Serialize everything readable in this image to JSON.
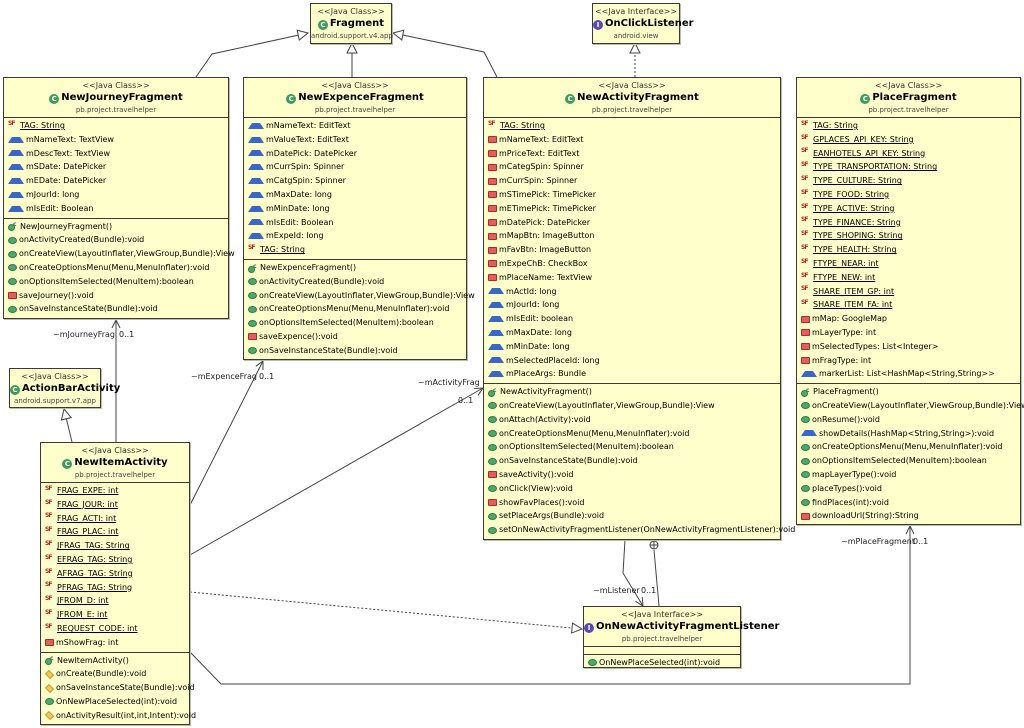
{
  "classes": {
    "fragment": {
      "stereotype": "<<Java Class>>",
      "name": "Fragment",
      "package": "android.support.v4.app",
      "kind": "class"
    },
    "onClickListener": {
      "stereotype": "<<Java Interface>>",
      "name": "OnClickListener",
      "package": "android.view",
      "kind": "interface"
    },
    "actionBarActivity": {
      "stereotype": "<<Java Class>>",
      "name": "ActionBarActivity",
      "package": "android.support.v7.app",
      "kind": "class"
    },
    "newJourneyFragment": {
      "stereotype": "<<Java Class>>",
      "name": "NewJourneyFragment",
      "package": "pb.project.travelhelper",
      "kind": "class",
      "fields": [
        {
          "vis": "sf",
          "text": "TAG: String",
          "static": true
        },
        {
          "vis": "pkgv",
          "text": "mNameText: TextView"
        },
        {
          "vis": "pkgv",
          "text": "mDescText: TextView"
        },
        {
          "vis": "pkgv",
          "text": "mSDate: DatePicker"
        },
        {
          "vis": "pkgv",
          "text": "mEDate: DatePicker"
        },
        {
          "vis": "pkgv",
          "text": "mJourId: long"
        },
        {
          "vis": "pkgv",
          "text": "mIsEdit: Boolean"
        }
      ],
      "methods": [
        {
          "vis": "ctor",
          "text": "NewJourneyFragment()"
        },
        {
          "vis": "pub",
          "text": "onActivityCreated(Bundle):void"
        },
        {
          "vis": "pub",
          "text": "onCreateView(LayoutInflater,ViewGroup,Bundle):View"
        },
        {
          "vis": "pub",
          "text": "onCreateOptionsMenu(Menu,MenuInflater):void"
        },
        {
          "vis": "pub",
          "text": "onOptionsItemSelected(MenuItem):boolean"
        },
        {
          "vis": "priv",
          "text": "saveJourney():void"
        },
        {
          "vis": "pub",
          "text": "onSaveInstanceState(Bundle):void"
        }
      ]
    },
    "newExpenceFragment": {
      "stereotype": "<<Java Class>>",
      "name": "NewExpenceFragment",
      "package": "pb.project.travelhelper",
      "kind": "class",
      "fields": [
        {
          "vis": "pkgv",
          "text": "mNameText: EditText"
        },
        {
          "vis": "pkgv",
          "text": "mValueText: EditText"
        },
        {
          "vis": "pkgv",
          "text": "mDatePick: DatePicker"
        },
        {
          "vis": "pkgv",
          "text": "mCurrSpin: Spinner"
        },
        {
          "vis": "pkgv",
          "text": "mCatgSpin: Spinner"
        },
        {
          "vis": "pkgv",
          "text": "mMaxDate: long"
        },
        {
          "vis": "pkgv",
          "text": "mMinDate: long"
        },
        {
          "vis": "pkgv",
          "text": "mIsEdit: Boolean"
        },
        {
          "vis": "pkgv",
          "text": "mExpeId: long"
        },
        {
          "vis": "sf",
          "text": "TAG: String",
          "static": true
        }
      ],
      "methods": [
        {
          "vis": "ctor",
          "text": "NewExpenceFragment()"
        },
        {
          "vis": "pub",
          "text": "onActivityCreated(Bundle):void"
        },
        {
          "vis": "pub",
          "text": "onCreateView(LayoutInflater,ViewGroup,Bundle):View"
        },
        {
          "vis": "pub",
          "text": "onCreateOptionsMenu(Menu,MenuInflater):void"
        },
        {
          "vis": "pub",
          "text": "onOptionsItemSelected(MenuItem):boolean"
        },
        {
          "vis": "priv",
          "text": "saveExpence():void"
        },
        {
          "vis": "pub",
          "text": "onSaveInstanceState(Bundle):void"
        }
      ]
    },
    "newActivityFragment": {
      "stereotype": "<<Java Class>>",
      "name": "NewActivityFragment",
      "package": "pb.project.travelhelper",
      "kind": "class",
      "fields": [
        {
          "vis": "sf",
          "text": "TAG: String",
          "static": true
        },
        {
          "vis": "priv",
          "text": "mNameText: EditText"
        },
        {
          "vis": "priv",
          "text": "mPriceText: EditText"
        },
        {
          "vis": "priv",
          "text": "mCategSpin: Spinner"
        },
        {
          "vis": "priv",
          "text": "mCurrSpin: Spinner"
        },
        {
          "vis": "priv",
          "text": "mSTimePick: TimePicker"
        },
        {
          "vis": "priv",
          "text": "mETimePick: TimePicker"
        },
        {
          "vis": "priv",
          "text": "mDatePick: DatePicker"
        },
        {
          "vis": "priv",
          "text": "mMapBtn: ImageButton"
        },
        {
          "vis": "priv",
          "text": "mFavBtn: ImageButton"
        },
        {
          "vis": "priv",
          "text": "mExpeChB: CheckBox"
        },
        {
          "vis": "priv",
          "text": "mPlaceName: TextView"
        },
        {
          "vis": "pkgv",
          "text": "mActId: long"
        },
        {
          "vis": "pkgv",
          "text": "mJourId: long"
        },
        {
          "vis": "pkgv",
          "text": "mIsEdit: boolean"
        },
        {
          "vis": "pkgv",
          "text": "mMaxDate: long"
        },
        {
          "vis": "pkgv",
          "text": "mMinDate: long"
        },
        {
          "vis": "pkgv",
          "text": "mSelectedPlaceId: long"
        },
        {
          "vis": "pkgv",
          "text": "mPlaceArgs: Bundle"
        }
      ],
      "methods": [
        {
          "vis": "ctor",
          "text": "NewActivityFragment()"
        },
        {
          "vis": "pub",
          "text": "onCreateView(LayoutInflater,ViewGroup,Bundle):View"
        },
        {
          "vis": "pub",
          "text": "onAttach(Activity):void"
        },
        {
          "vis": "pub",
          "text": "onCreateOptionsMenu(Menu,MenuInflater):void"
        },
        {
          "vis": "pub",
          "text": "onOptionsItemSelected(MenuItem):boolean"
        },
        {
          "vis": "pub",
          "text": "onSaveInstanceState(Bundle):void"
        },
        {
          "vis": "priv",
          "text": "saveActivity():void"
        },
        {
          "vis": "pub",
          "text": "onClick(View):void"
        },
        {
          "vis": "priv",
          "text": "showFavPlaces():void"
        },
        {
          "vis": "pub",
          "text": "setPlaceArgs(Bundle):void"
        },
        {
          "vis": "pub",
          "text": "setOnNewActivityFragmentListener(OnNewActivityFragmentListener):void"
        }
      ]
    },
    "placeFragment": {
      "stereotype": "<<Java Class>>",
      "name": "PlaceFragment",
      "package": "pb.project.travelhelper",
      "kind": "class",
      "fields": [
        {
          "vis": "sf",
          "text": "TAG: String",
          "static": true
        },
        {
          "vis": "sf",
          "text": "GPLACES_API_KEY: String",
          "static": true
        },
        {
          "vis": "sf",
          "text": "EANHOTELS_API_KEY: String",
          "static": true
        },
        {
          "vis": "sf",
          "text": "TYPE_TRANSPORTATION: String",
          "static": true
        },
        {
          "vis": "sf",
          "text": "TYPE_CULTURE: String",
          "static": true
        },
        {
          "vis": "sf",
          "text": "TYPE_FOOD: String",
          "static": true
        },
        {
          "vis": "sf",
          "text": "TYPE_ACTIVE: String",
          "static": true
        },
        {
          "vis": "sf",
          "text": "TYPE_FINANCE: String",
          "static": true
        },
        {
          "vis": "sf",
          "text": "TYPE_SHOPING: String",
          "static": true
        },
        {
          "vis": "sf",
          "text": "TYPE_HEALTH: String",
          "static": true
        },
        {
          "vis": "sf",
          "text": "FTYPE_NEAR: int",
          "static": true
        },
        {
          "vis": "sf",
          "text": "FTYPE_NEW: int",
          "static": true
        },
        {
          "vis": "sf",
          "text": "SHARE_ITEM_GP: int",
          "static": true
        },
        {
          "vis": "sf",
          "text": "SHARE_ITEM_FA: int",
          "static": true
        },
        {
          "vis": "priv",
          "text": "mMap: GoogleMap"
        },
        {
          "vis": "priv",
          "text": "mLayerType: int"
        },
        {
          "vis": "priv",
          "text": "mSelectedTypes: List<Integer>"
        },
        {
          "vis": "priv",
          "text": "mFragType: int"
        },
        {
          "vis": "pkgv",
          "text": "markerList: List<HashMap<String,String>>"
        }
      ],
      "methods": [
        {
          "vis": "ctor",
          "text": "PlaceFragment()"
        },
        {
          "vis": "pub",
          "text": "onCreateView(LayoutInflater,ViewGroup,Bundle):View"
        },
        {
          "vis": "pub",
          "text": "onResume():void"
        },
        {
          "vis": "pkgv",
          "text": "showDetails(HashMap<String,String>):void"
        },
        {
          "vis": "pub",
          "text": "onCreateOptionsMenu(Menu,MenuInflater):void"
        },
        {
          "vis": "pub",
          "text": "onOptionsItemSelected(MenuItem):boolean"
        },
        {
          "vis": "pub",
          "text": "mapLayerType():void"
        },
        {
          "vis": "pub",
          "text": "placeTypes():void"
        },
        {
          "vis": "pub",
          "text": "findPlaces(int):void"
        },
        {
          "vis": "priv",
          "text": "downloadUrl(String):String"
        }
      ]
    },
    "newItemActivity": {
      "stereotype": "<<Java Class>>",
      "name": "NewItemActivity",
      "package": "pb.project.travelhelper",
      "kind": "class",
      "fields": [
        {
          "vis": "sf",
          "text": "FRAG_EXPE: int",
          "static": true
        },
        {
          "vis": "sf",
          "text": "FRAG_JOUR: int",
          "static": true
        },
        {
          "vis": "sf",
          "text": "FRAG_ACTI: int",
          "static": true
        },
        {
          "vis": "sf",
          "text": "FRAG_PLAC: int",
          "static": true
        },
        {
          "vis": "sf",
          "text": "JFRAG_TAG: String",
          "static": true
        },
        {
          "vis": "sf",
          "text": "EFRAG_TAG: String",
          "static": true
        },
        {
          "vis": "sf",
          "text": "AFRAG_TAG: String",
          "static": true
        },
        {
          "vis": "sf",
          "text": "PFRAG_TAG: String",
          "static": true
        },
        {
          "vis": "sf",
          "text": "JFROM_D: int",
          "static": true
        },
        {
          "vis": "sf",
          "text": "JFROM_E: int",
          "static": true
        },
        {
          "vis": "sf",
          "text": "REQUEST_CODE: int",
          "static": true
        },
        {
          "vis": "priv",
          "text": "mShowFrag: int"
        }
      ],
      "methods": [
        {
          "vis": "ctor",
          "text": "NewItemActivity()"
        },
        {
          "vis": "prot",
          "text": "onCreate(Bundle):void"
        },
        {
          "vis": "prot",
          "text": "onSaveInstanceState(Bundle):void"
        },
        {
          "vis": "pub",
          "text": "OnNewPlaceSelected(int):void"
        },
        {
          "vis": "prot",
          "text": "onActivityResult(int,int,Intent):void"
        }
      ]
    },
    "onNewActivityFragmentListener": {
      "stereotype": "<<Java Interface>>",
      "name": "OnNewActivityFragmentListener",
      "package": "pb.project.travelhelper",
      "kind": "interface",
      "fields": [],
      "methods": [
        {
          "vis": "pub",
          "text": "OnNewPlaceSelected(int):void"
        }
      ]
    }
  },
  "associations": [
    {
      "role": "~mJourneyFrag",
      "multiplicity": "0..1"
    },
    {
      "role": "~mExpenceFrag",
      "multiplicity": "0..1"
    },
    {
      "role": "~mActivityFrag",
      "multiplicity": "0..1"
    },
    {
      "role": "~mPlaceFragment",
      "multiplicity": "0..1"
    },
    {
      "role": "~mListener",
      "multiplicity": "0..1"
    }
  ],
  "icons": {
    "class": "class-icon (green circle C)",
    "interface": "interface-icon (purple circle I)",
    "pub": "public-icon (green dot)",
    "priv": "private-icon (red square)",
    "prot": "protected-icon (yellow diamond)",
    "pkgv": "package-icon (blue triangle)",
    "sf": "static-final-icon",
    "ctor": "constructor-icon"
  }
}
